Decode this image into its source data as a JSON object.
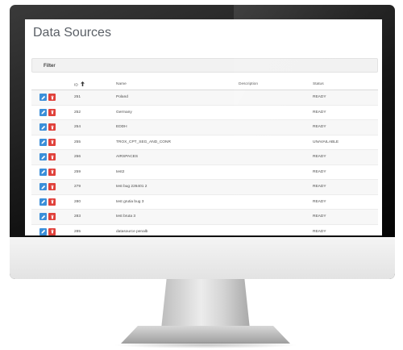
{
  "page": {
    "title": "Data Sources"
  },
  "filter": {
    "label": "Filter"
  },
  "table": {
    "columns": {
      "id": "ID",
      "name": "Name",
      "description": "Description",
      "status": "Status"
    },
    "sort": {
      "column": "ID",
      "direction": "ascending"
    },
    "rows": [
      {
        "id": "251",
        "name": "Poland",
        "description": "",
        "status": "READY"
      },
      {
        "id": "252",
        "name": "Germany",
        "description": "",
        "status": "READY"
      },
      {
        "id": "254",
        "name": "EDDH",
        "description": "",
        "status": "READY"
      },
      {
        "id": "255",
        "name": "TROX_CPT_SEG_AND_CONR",
        "description": "",
        "status": "UNAVAILABLE"
      },
      {
        "id": "256",
        "name": "AIRSPACES",
        "description": "",
        "status": "READY"
      },
      {
        "id": "259",
        "name": "test2",
        "description": "",
        "status": "READY"
      },
      {
        "id": "279",
        "name": "test bug 226401 2",
        "description": "",
        "status": "READY"
      },
      {
        "id": "280",
        "name": "test grutia bug 3",
        "description": "",
        "status": "READY"
      },
      {
        "id": "283",
        "name": "test bruta 3",
        "description": "",
        "status": "READY"
      },
      {
        "id": "285",
        "name": "datasource penalb",
        "description": "",
        "status": "READY"
      }
    ]
  },
  "icons": {
    "edit": "pencil-icon",
    "delete": "trash-icon",
    "sort": "arrow-up-icon"
  },
  "colors": {
    "edit_button": "#3b8fd9",
    "delete_button": "#e0413b",
    "title_text": "#5a5f66"
  }
}
